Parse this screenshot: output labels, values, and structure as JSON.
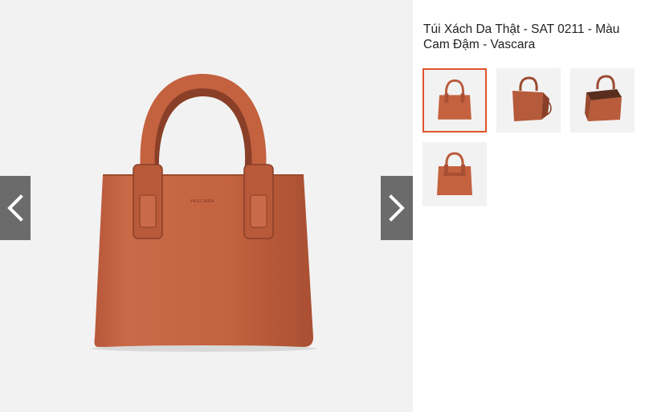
{
  "product": {
    "title": "Túi Xách Da Thật - SAT 0211 - Màu Cam Đậm - Vascara",
    "brand_mark": "VASCARA"
  },
  "gallery": {
    "prev_icon": "chevron-left-icon",
    "next_icon": "chevron-right-icon",
    "thumbnails": [
      {
        "view": "front",
        "active": true
      },
      {
        "view": "angled",
        "active": false
      },
      {
        "view": "open-top",
        "active": false
      },
      {
        "view": "back",
        "active": false
      }
    ]
  },
  "colors": {
    "bag": "#c2613f",
    "bag_dark": "#9b4a2f",
    "active_border": "#e0542e",
    "arrow_bg": "#6b6b6b"
  }
}
